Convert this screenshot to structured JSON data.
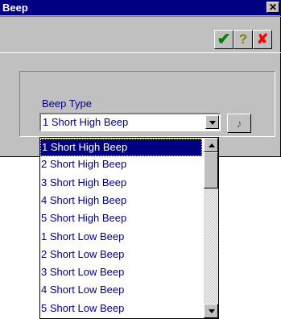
{
  "window": {
    "title": "Beep",
    "close_glyph": "✕"
  },
  "toolbar": {
    "ok_glyph": "✔",
    "help_glyph": "?",
    "cancel_glyph": "✘",
    "colors": {
      "ok": "#008000",
      "help": "#808000",
      "cancel": "#ff0000"
    }
  },
  "form": {
    "beep_type_label": "Beep Type",
    "beep_type_value": "1 Short High Beep",
    "play_icon": "speaker-play-icon",
    "play_glyph": "♪"
  },
  "dropdown": {
    "selected_index": 0,
    "items": [
      "1 Short High Beep",
      "2 Short High Beep",
      "3 Short High Beep",
      "4 Short High Beep",
      "5 Short High Beep",
      "1 Short Low Beep",
      "2 Short Low Beep",
      "3 Short Low Beep",
      "4 Short Low Beep",
      "5 Short Low Beep"
    ]
  }
}
